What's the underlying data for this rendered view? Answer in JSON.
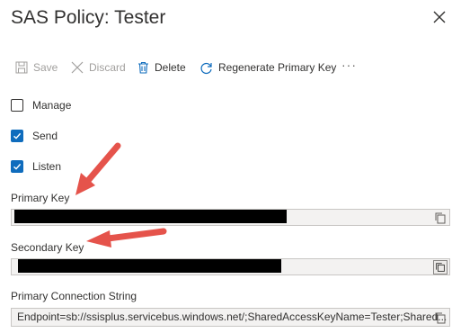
{
  "header": {
    "title": "SAS Policy: Tester",
    "close_icon": "close-icon"
  },
  "toolbar": {
    "save_label": "Save",
    "discard_label": "Discard",
    "delete_label": "Delete",
    "regenerate_label": "Regenerate Primary Key",
    "more_label": "···"
  },
  "claims": [
    {
      "label": "Manage",
      "checked": false
    },
    {
      "label": "Send",
      "checked": true
    },
    {
      "label": "Listen",
      "checked": true
    }
  ],
  "keys": {
    "primary_key_label": "Primary Key",
    "secondary_key_label": "Secondary Key",
    "primary_connection_label": "Primary Connection String",
    "primary_connection_value": "Endpoint=sb://ssisplus.servicebus.windows.net/;SharedAccessKeyName=Tester;Shared..."
  },
  "colors": {
    "accent": "#0f6cbd",
    "annotation_arrow": "#e5534b"
  }
}
